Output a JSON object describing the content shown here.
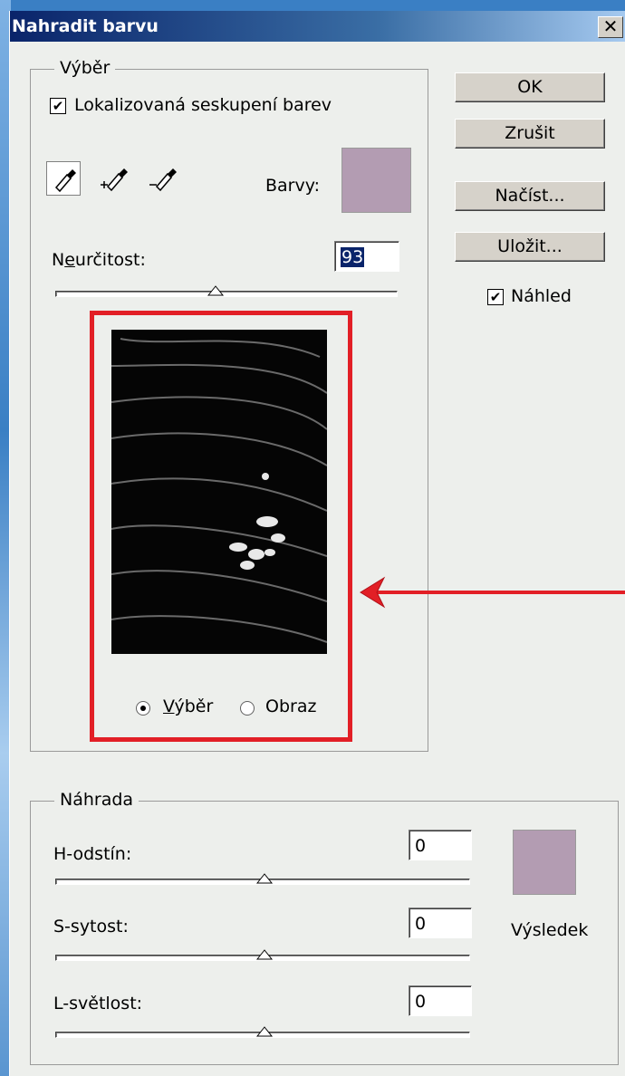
{
  "window": {
    "title": "Nahradit barvu",
    "close_label": "✕"
  },
  "selection_group": {
    "label": "Výběr",
    "localized_checkbox": {
      "label": "Lokalizovaná seskupení barev",
      "checked": true
    },
    "tools": [
      "eyedropper-icon",
      "eyedropper-plus-icon",
      "eyedropper-minus-icon"
    ],
    "colors_label": "Barvy:",
    "colors_swatch": "#b39cb2",
    "fuzziness": {
      "label": "Neurčitost:",
      "value": "93",
      "level": 0.47
    },
    "view_options": [
      {
        "label": "Výběr",
        "selected": true
      },
      {
        "label": "Obraz",
        "selected": false
      }
    ]
  },
  "buttons": {
    "ok": "OK",
    "cancel": "Zrušit",
    "load": "Načíst...",
    "save": "Uložit..."
  },
  "preview_checkbox": {
    "label": "Náhled",
    "checked": true
  },
  "replacement_group": {
    "label": "Náhrada",
    "hue": {
      "label": "H-odstín:",
      "value": "0",
      "level": 0.5
    },
    "saturation": {
      "label": "S-sytost:",
      "value": "0",
      "level": 0.5
    },
    "lightness": {
      "label": "L-světlost:",
      "value": "0",
      "level": 0.5
    },
    "result_label": "Výsledek",
    "result_swatch": "#b39cb2"
  },
  "colors": {
    "highlight": "#e21f26",
    "arrow": "#e21f26"
  }
}
